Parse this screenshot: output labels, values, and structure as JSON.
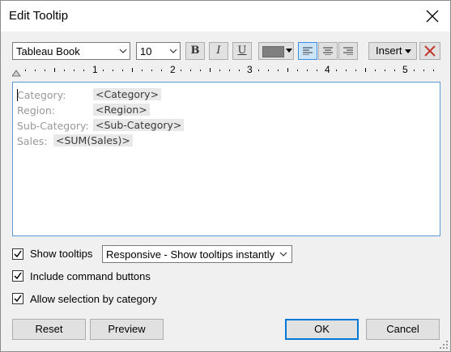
{
  "window": {
    "title": "Edit Tooltip"
  },
  "toolbar": {
    "font_family": "Tableau Book",
    "font_size": "10",
    "bold_label": "B",
    "italic_label": "I",
    "underline_label": "U",
    "text_color": "#808080",
    "insert_label": "Insert",
    "ruler_numbers": [
      "1",
      "2",
      "3",
      "4",
      "5"
    ]
  },
  "editor": {
    "lines": [
      {
        "label": "Category:",
        "field": "<Category>"
      },
      {
        "label": "Region:",
        "field": "<Region>"
      },
      {
        "label": "Sub-Category:",
        "field": "<Sub-Category>"
      },
      {
        "label": "Sales:",
        "field": "<SUM(Sales)>"
      }
    ]
  },
  "options": {
    "show_tooltips_label": "Show tooltips",
    "show_tooltips_checked": true,
    "tooltip_mode": "Responsive - Show tooltips instantly",
    "include_buttons_label": "Include command buttons",
    "include_buttons_checked": true,
    "allow_selection_label": "Allow selection by category",
    "allow_selection_checked": true
  },
  "buttons": {
    "reset": "Reset",
    "preview": "Preview",
    "ok": "OK",
    "cancel": "Cancel"
  },
  "colors": {
    "accent": "#0078d7",
    "editor_border": "#5b9bd5"
  }
}
